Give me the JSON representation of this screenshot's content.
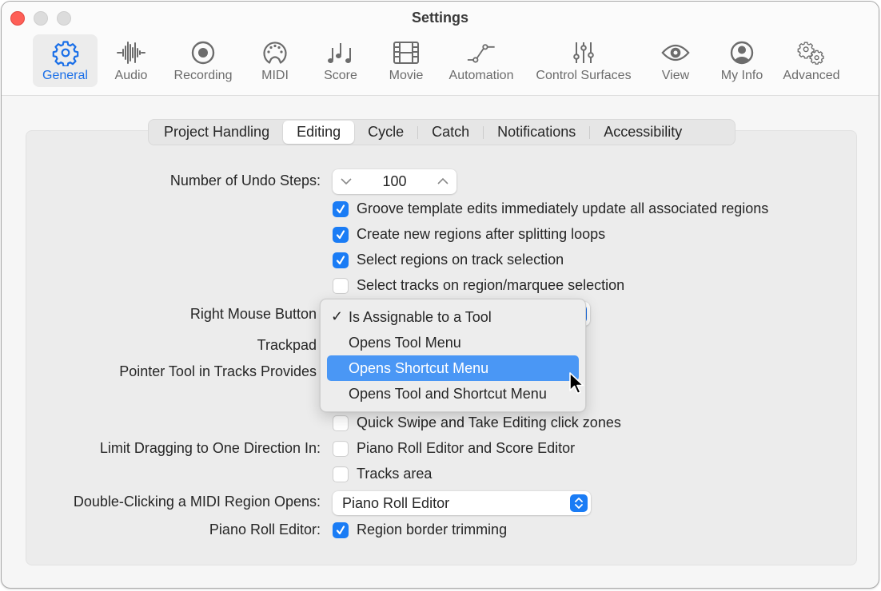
{
  "window": {
    "title": "Settings"
  },
  "toolbar": {
    "items": [
      {
        "label": "General",
        "icon": "gear-icon",
        "active": true
      },
      {
        "label": "Audio",
        "icon": "waveform-icon",
        "active": false
      },
      {
        "label": "Recording",
        "icon": "record-icon",
        "active": false
      },
      {
        "label": "MIDI",
        "icon": "midi-connector-icon",
        "active": false
      },
      {
        "label": "Score",
        "icon": "music-notes-icon",
        "active": false
      },
      {
        "label": "Movie",
        "icon": "film-strip-icon",
        "active": false
      },
      {
        "label": "Automation",
        "icon": "automation-curve-icon",
        "active": false
      },
      {
        "label": "Control Surfaces",
        "icon": "sliders-icon",
        "active": false
      },
      {
        "label": "View",
        "icon": "eye-icon",
        "active": false
      },
      {
        "label": "My Info",
        "icon": "person-circle-icon",
        "active": false
      },
      {
        "label": "Advanced",
        "icon": "gears-icon",
        "active": false
      }
    ]
  },
  "tabs": {
    "items": [
      {
        "label": "Project Handling",
        "active": false
      },
      {
        "label": "Editing",
        "active": true
      },
      {
        "label": "Cycle",
        "active": false
      },
      {
        "label": "Catch",
        "active": false
      },
      {
        "label": "Notifications",
        "active": false
      },
      {
        "label": "Accessibility",
        "active": false
      }
    ]
  },
  "editing": {
    "undo_steps": {
      "label": "Number of Undo Steps:",
      "value": "100"
    },
    "checkboxes": [
      {
        "label": "Groove template edits immediately update all associated regions",
        "checked": true
      },
      {
        "label": "Create new regions after splitting loops",
        "checked": true
      },
      {
        "label": "Select regions on track selection",
        "checked": true
      },
      {
        "label": "Select tracks on region/marquee selection",
        "checked": false
      }
    ],
    "right_mouse_button": {
      "label": "Right Mouse Button"
    },
    "trackpad": {
      "label": "Trackpad"
    },
    "pointer_tool": {
      "label": "Pointer Tool in Tracks Provides"
    },
    "quick_swipe": {
      "label": "Quick Swipe and Take Editing click zones",
      "checked": false
    },
    "limit_dragging": {
      "label": "Limit Dragging to One Direction In:",
      "options": [
        {
          "label": "Piano Roll Editor and Score Editor",
          "checked": false
        },
        {
          "label": "Tracks area",
          "checked": false
        }
      ]
    },
    "double_click_midi": {
      "label": "Double-Clicking a MIDI Region Opens:",
      "value": "Piano Roll Editor"
    },
    "piano_roll_editor": {
      "label": "Piano Roll Editor:",
      "option": {
        "label": "Region border trimming",
        "checked": true
      }
    }
  },
  "right_mouse_menu": {
    "items": [
      {
        "label": "Is Assignable to a Tool",
        "checked": true,
        "highlighted": false
      },
      {
        "label": "Opens Tool Menu",
        "checked": false,
        "highlighted": false
      },
      {
        "label": "Opens Shortcut Menu",
        "checked": false,
        "highlighted": true
      },
      {
        "label": "Opens Tool and Shortcut Menu",
        "checked": false,
        "highlighted": false
      }
    ],
    "check_glyph": "✓"
  },
  "colors": {
    "accent": "#1a7cf5",
    "menu_highlight": "#4a97f5",
    "close_button": "#fe5f57"
  }
}
